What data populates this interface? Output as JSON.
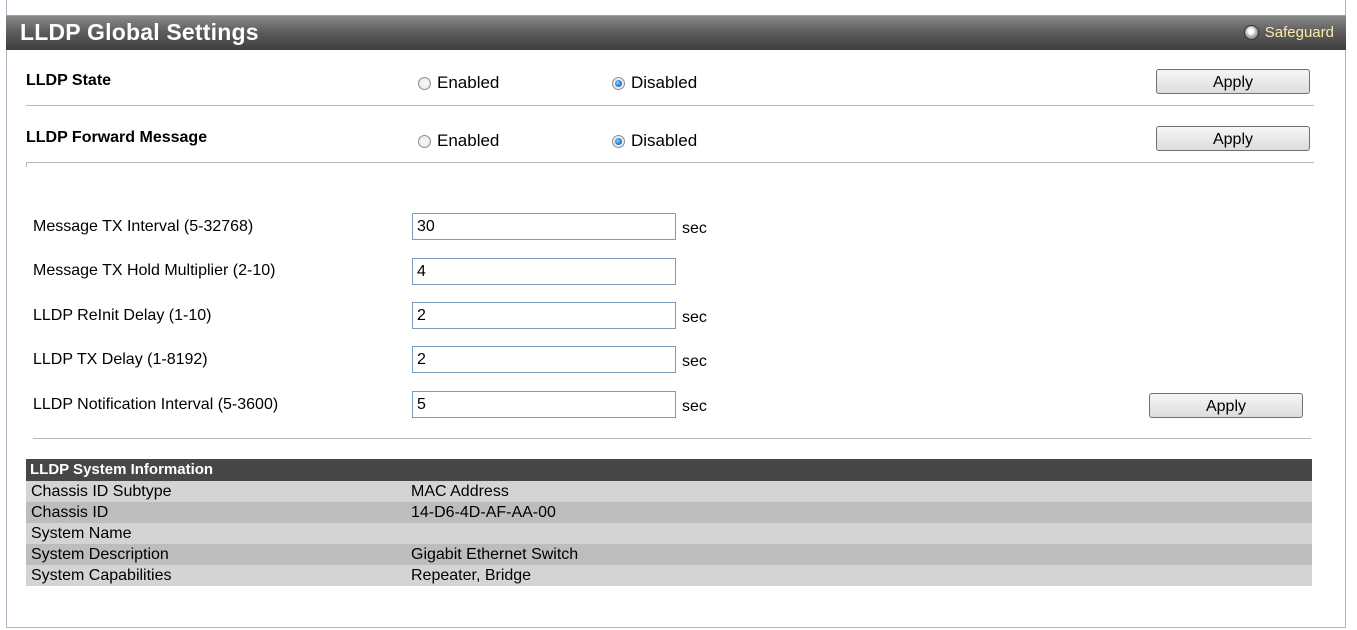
{
  "window": {
    "title": "LLDP Global Settings",
    "safeguard_label": "Safeguard"
  },
  "lldp_state": {
    "label": "LLDP State",
    "options": [
      "Enabled",
      "Disabled"
    ],
    "selected": "Disabled",
    "apply_label": "Apply"
  },
  "lldp_forward": {
    "label": "LLDP Forward Message",
    "options": [
      "Enabled",
      "Disabled"
    ],
    "selected": "Disabled",
    "apply_label": "Apply"
  },
  "fields": [
    {
      "label": "Message TX Interval (5-32768)",
      "value": "30",
      "unit": "sec"
    },
    {
      "label": "Message TX Hold Multiplier (2-10)",
      "value": "4",
      "unit": ""
    },
    {
      "label": "LLDP ReInit Delay (1-10)",
      "value": "2",
      "unit": "sec"
    },
    {
      "label": "LLDP TX Delay (1-8192)",
      "value": "2",
      "unit": "sec"
    },
    {
      "label": "LLDP Notification Interval (5-3600)",
      "value": "5",
      "unit": "sec"
    }
  ],
  "fields_apply_label": "Apply",
  "system_info": {
    "header": "LLDP System Information",
    "rows": [
      {
        "key": "Chassis ID Subtype",
        "value": "MAC Address"
      },
      {
        "key": "Chassis ID",
        "value": "14-D6-4D-AF-AA-00"
      },
      {
        "key": "System Name",
        "value": ""
      },
      {
        "key": "System Description",
        "value": "Gigabit Ethernet Switch"
      },
      {
        "key": "System Capabilities",
        "value": "Repeater, Bridge"
      }
    ]
  },
  "colors": {
    "title_bar": "#5e5e5e",
    "table_header": "#474747",
    "safeguard_text": "#ffe9a8"
  }
}
